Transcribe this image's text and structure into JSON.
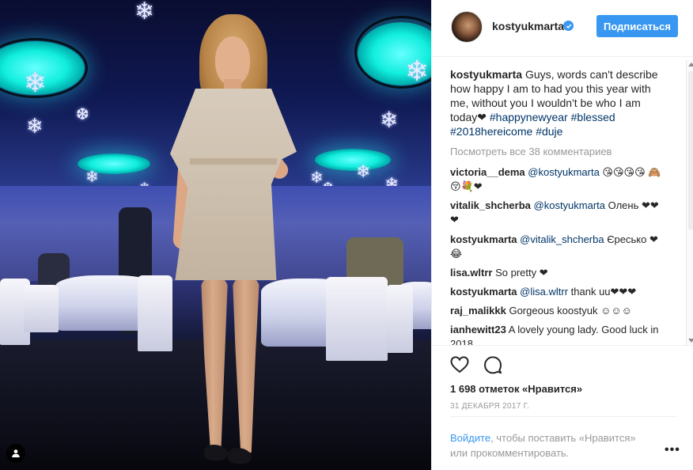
{
  "post": {
    "username": "kostyukmarta",
    "follow_label": "Подписаться",
    "caption": {
      "username": "kostyukmarta",
      "text": "Guys, words can't describe how happy I am to had you this year with me, without you I wouldn't be who I am today❤ ",
      "hashtags": [
        "#happynewyear",
        "#blessed",
        "#2018hereicome",
        "#duje"
      ]
    },
    "view_all_comments": "Посмотреть все 38 комментариев",
    "comments": [
      {
        "username": "victoria__dema",
        "mention": "@kostyukmarta",
        "text": " 😘😘😘😘 🙈😚💐❤"
      },
      {
        "username": "vitalik_shcherba",
        "mention": "@kostyukmarta",
        "text": " Олень ❤❤❤"
      },
      {
        "username": "kostyukmarta",
        "mention": "@vitalik_shcherba",
        "text": " Єресько ❤😂"
      },
      {
        "username": "lisa.wltrr",
        "mention": "",
        "text": "So pretty ❤"
      },
      {
        "username": "kostyukmarta",
        "mention": "@lisa.wltrr",
        "text": " thank uu❤❤❤"
      },
      {
        "username": "raj_malikkk",
        "mention": "",
        "text": "Gorgeous koostyuk ☺☺☺"
      },
      {
        "username": "ianhewitt23",
        "mention": "",
        "text": "A lovely young lady. Good luck in 2018"
      }
    ],
    "likes": "1 698 отметок «Нравится»",
    "date": "31 ДЕКАБРЯ 2017 Г.",
    "login": {
      "link": "Войдите",
      "rest": ", чтобы поставить «Нравится» или прокомментировать."
    },
    "more": "•••"
  },
  "colors": {
    "accent": "#3897f0",
    "link": "#003569",
    "muted": "#999999",
    "text": "#262626"
  },
  "icons": [
    "user-tag-icon",
    "verified-icon",
    "heart-icon",
    "comment-icon",
    "more-icon"
  ]
}
